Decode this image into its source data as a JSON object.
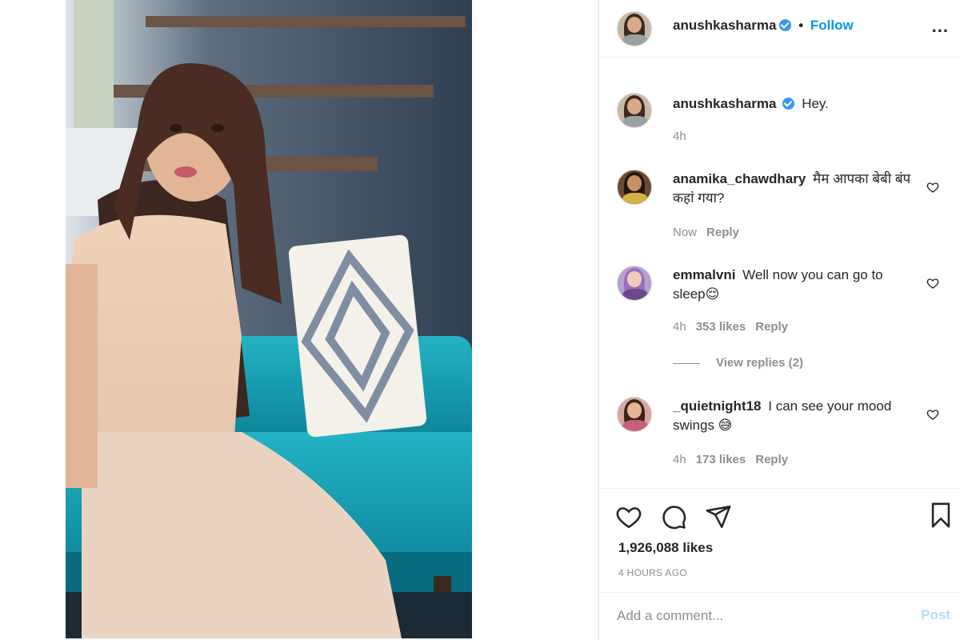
{
  "post": {
    "author": "anushkasharma",
    "follow_label": "Follow",
    "separator": "•",
    "more_label": "...",
    "caption": "Hey.",
    "caption_time": "4h"
  },
  "comments": [
    {
      "username": "anamika_chawdhary",
      "text": "मैम आपका बेबी बंप कहां गया?",
      "time": "Now",
      "likes": "",
      "reply_label": "Reply"
    },
    {
      "username": "emmalvni",
      "text": "Well now you can go to sleep😌",
      "time": "4h",
      "likes": "353 likes",
      "reply_label": "Reply",
      "view_replies": "View replies (2)"
    },
    {
      "username": "_quietnight18",
      "text": "I can see your mood swings 😅",
      "time": "4h",
      "likes": "173 likes",
      "reply_label": "Reply"
    }
  ],
  "actions": {
    "likes": "1,926,088 likes",
    "posted": "4 HOURS AGO",
    "icons": [
      "heart-icon",
      "comment-icon",
      "share-icon",
      "bookmark-icon"
    ]
  },
  "composer": {
    "placeholder": "Add a comment...",
    "post_label": "Post"
  },
  "colors": {
    "accent": "#0095f6",
    "post_disabled": "#b2dffc",
    "muted": "#8e8e8e",
    "verified": "#3897f0"
  }
}
